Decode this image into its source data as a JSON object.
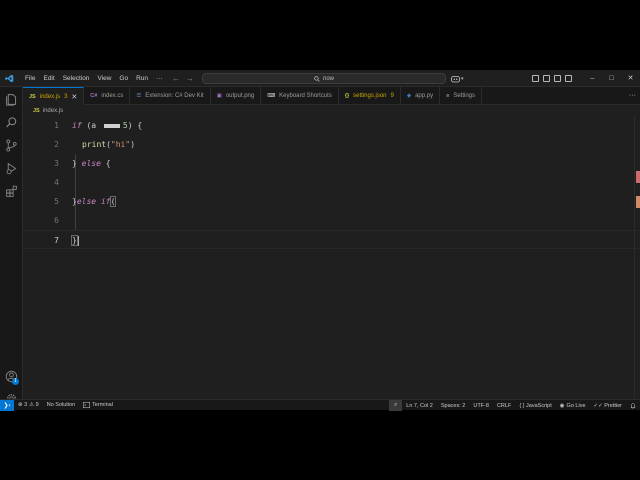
{
  "menu": [
    "File",
    "Edit",
    "Selection",
    "View",
    "Go",
    "Run",
    "···"
  ],
  "search": {
    "text": "now",
    "icon": "search-icon"
  },
  "window_controls": {
    "minimize": "–",
    "maximize": "□",
    "close": "✕"
  },
  "tabs": [
    {
      "label": "index.js",
      "icon_text": "JS",
      "icon_class": "js",
      "modified": "3",
      "close": "✕",
      "active": true
    },
    {
      "label": "index.cs",
      "icon_text": "C#",
      "icon_class": "cs"
    },
    {
      "label": "Extension: C# Dev Kit",
      "icon_text": "☰",
      "icon_class": "ext"
    },
    {
      "label": "output.png",
      "icon_text": "▣",
      "icon_class": "img"
    },
    {
      "label": "Keyboard Shortcuts",
      "icon_text": "⌨",
      "icon_class": "kb"
    },
    {
      "label": "settings.json",
      "icon_text": "{}",
      "icon_class": "json",
      "modified": "9",
      "warn": true
    },
    {
      "label": "app.py",
      "icon_text": "◆",
      "icon_class": "py"
    },
    {
      "label": "Settings",
      "icon_text": "≡",
      "icon_class": "set"
    }
  ],
  "tab_overflow": "···",
  "breadcrumb": {
    "icon_text": "JS",
    "file": "index.js"
  },
  "editor": {
    "line_numbers": [
      "1",
      "2",
      "3",
      "4",
      "5",
      "6",
      "7"
    ],
    "line1": {
      "kw": "if",
      "open": " (a ",
      "num": "5",
      "close": ") {"
    },
    "line2": {
      "fn": "print",
      "open": "(",
      "str": "\"hi\"",
      "close": ")"
    },
    "line3": {
      "brace": "} ",
      "kw": "else",
      "tail": " {"
    },
    "line5": {
      "brace": "}",
      "kw1": "else",
      "kw2": "if",
      "paren": "("
    },
    "line7": {
      "brace": "}"
    }
  },
  "activity_badge": "1",
  "status": {
    "remote": "❯‹",
    "errors": "⊗ 3",
    "warnings": "⚠ 9",
    "solution": "No Solution",
    "terminal": "Terminal",
    "zoom": "⌕",
    "position": "Ln 7, Col 2",
    "spaces": "Spaces: 2",
    "encoding": "UTF-8",
    "eol": "CRLF",
    "language": "{ } JavaScript",
    "golive": "Go Live",
    "prettier": "✓✓ Prettier",
    "notifications": "🔔"
  }
}
